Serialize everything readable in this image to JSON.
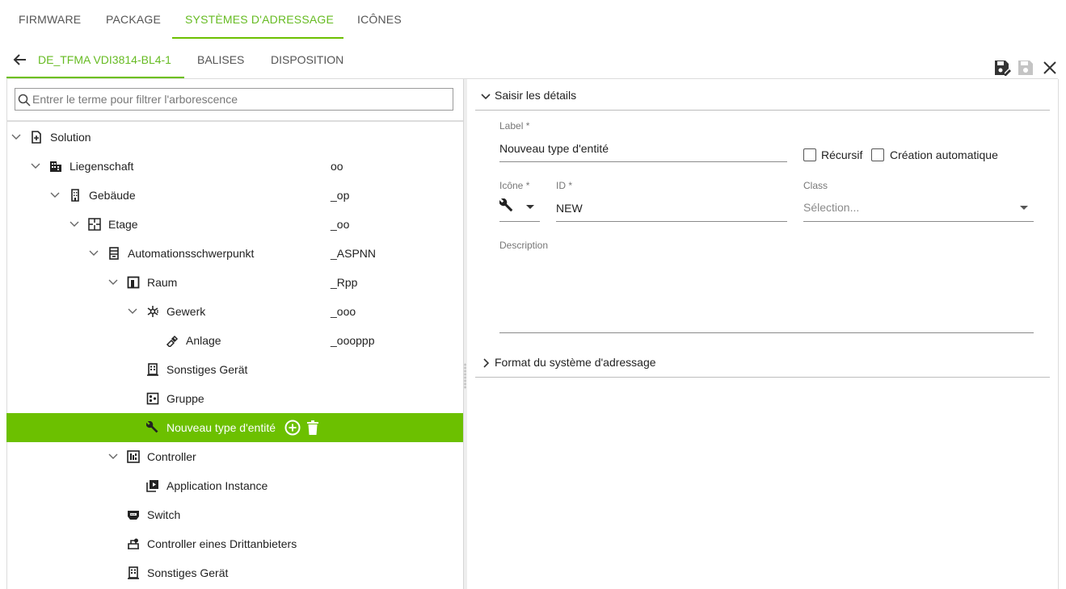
{
  "top_tabs": [
    {
      "label": "FIRMWARE"
    },
    {
      "label": "PACKAGE"
    },
    {
      "label": "SYSTÈMES D'ADRESSAGE"
    },
    {
      "label": "ICÔNES"
    }
  ],
  "sub_tabs": [
    {
      "label": "DE_TFMA VDI3814-BL4-1"
    },
    {
      "label": "BALISES"
    },
    {
      "label": "DISPOSITION"
    }
  ],
  "filter": {
    "placeholder": "Entrer le terme pour filtrer l'arborescence"
  },
  "tree": [
    {
      "label": "Solution",
      "code": "",
      "icon": "document-add-icon",
      "expanded": true
    },
    {
      "label": "Liegenschaft",
      "code": "oo",
      "icon": "building-icon",
      "expanded": true
    },
    {
      "label": "Gebäude",
      "code": "_op",
      "icon": "office-building-icon",
      "expanded": true
    },
    {
      "label": "Etage",
      "code": "_oo",
      "icon": "floor-plan-icon",
      "expanded": true
    },
    {
      "label": "Automationsschwerpunkt",
      "code": "_ASPNN",
      "icon": "cabinet-icon",
      "expanded": true
    },
    {
      "label": "Raum",
      "code": "_Rpp",
      "icon": "room-icon",
      "expanded": true
    },
    {
      "label": "Gewerk",
      "code": "_ooo",
      "icon": "hvac-icon",
      "expanded": true
    },
    {
      "label": "Anlage",
      "code": "_oooppp",
      "icon": "pipe-icon"
    },
    {
      "label": "Sonstiges Gerät",
      "code": "",
      "icon": "device-icon"
    },
    {
      "label": "Gruppe",
      "code": "",
      "icon": "group-icon"
    },
    {
      "label": "Nouveau type d'entité",
      "code": "",
      "icon": "wrench-icon",
      "selected": true
    },
    {
      "label": "Controller",
      "code": "",
      "icon": "controller-icon",
      "expanded": true
    },
    {
      "label": "Application Instance",
      "code": "",
      "icon": "application-icon"
    },
    {
      "label": "Switch",
      "code": "",
      "icon": "switch-icon"
    },
    {
      "label": "Controller eines Drittanbieters",
      "code": "",
      "icon": "third-party-controller-icon"
    },
    {
      "label": "Sonstiges Gerät",
      "code": "",
      "icon": "device-icon"
    }
  ],
  "details": {
    "section_title": "Saisir les détails",
    "label_caption": "Label *",
    "label_value": "Nouveau type d'entité",
    "recursive_label": "Récursif",
    "auto_create_label": "Création automatique",
    "icon_caption": "Icône *",
    "id_caption": "ID *",
    "id_value": "NEW",
    "class_caption": "Class",
    "class_placeholder": "Sélection...",
    "description_caption": "Description",
    "description_value": ""
  },
  "format_section": {
    "title": "Format du système d'adressage"
  },
  "colors": {
    "accent": "#6cc000",
    "accent_text": "#66bb22"
  }
}
